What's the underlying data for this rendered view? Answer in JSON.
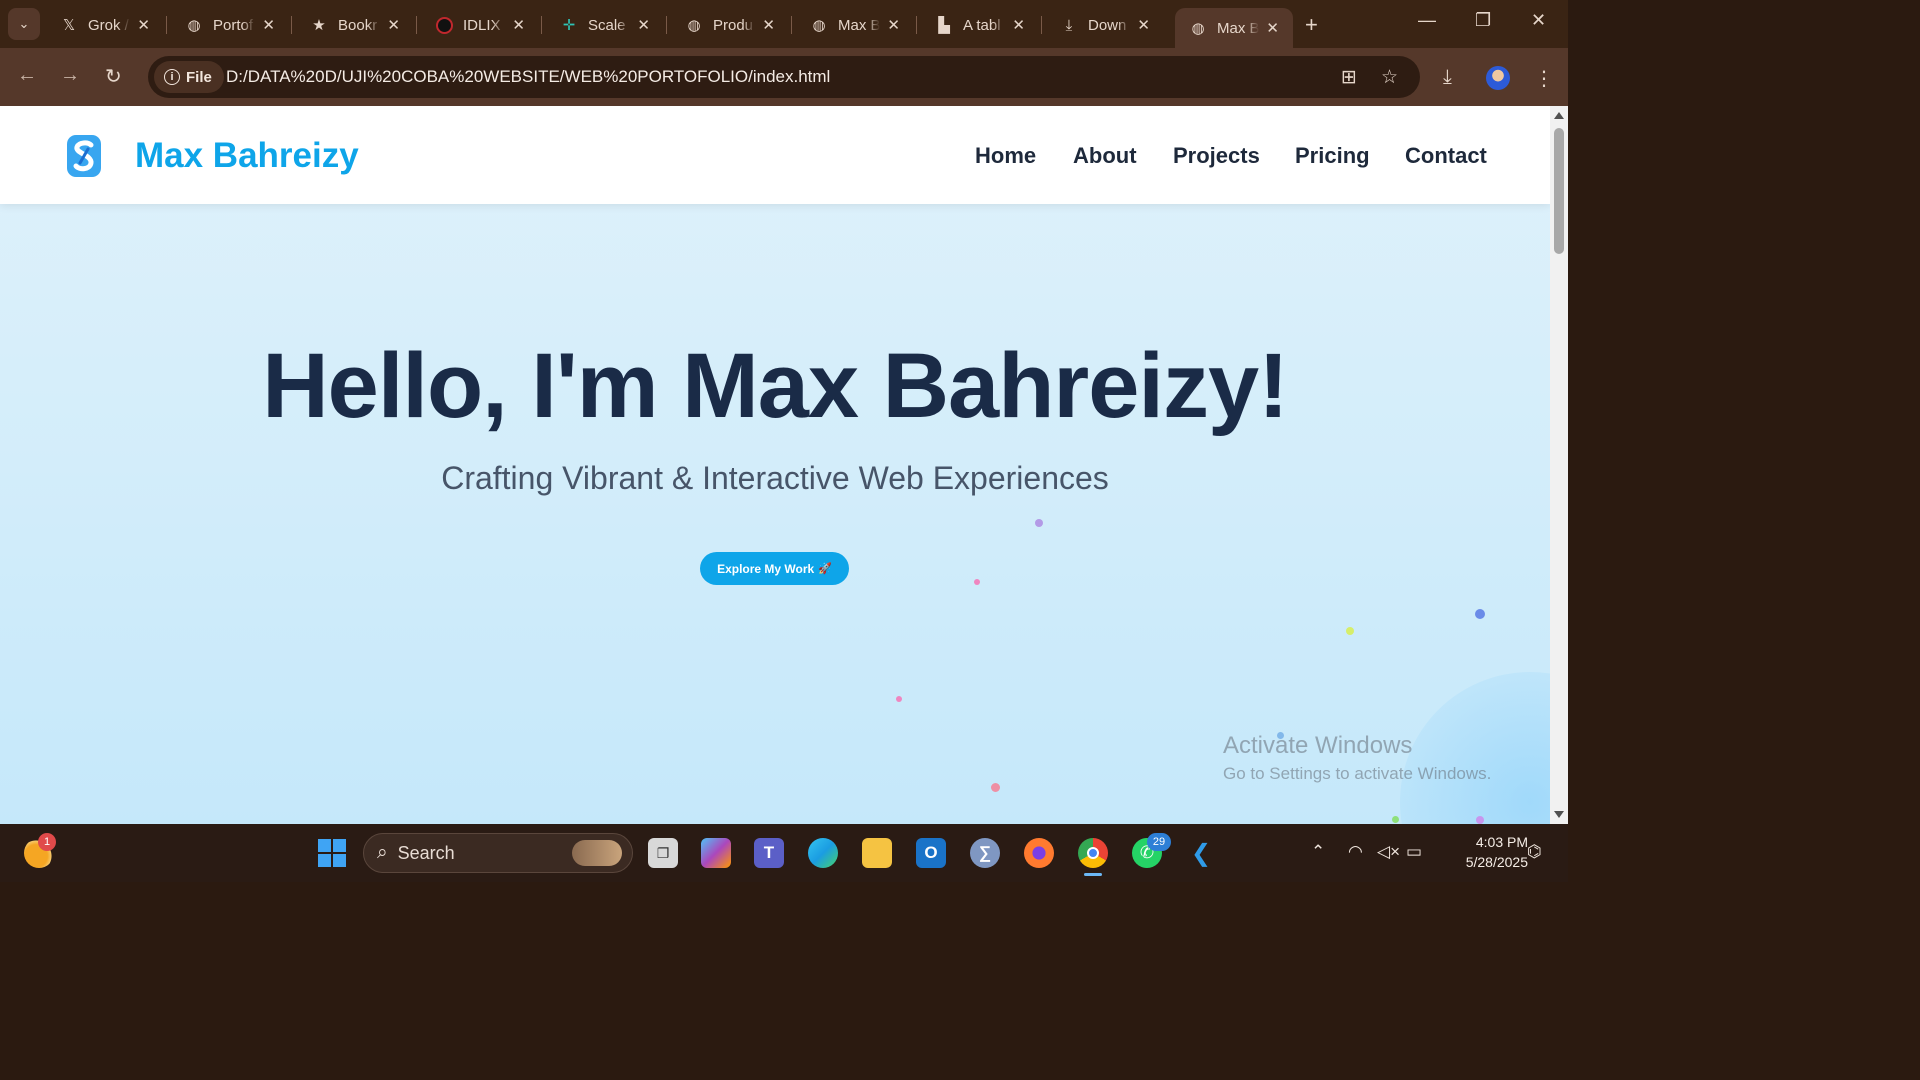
{
  "browser": {
    "tabs": [
      {
        "title": "Grok /",
        "icon": "x-logo-icon"
      },
      {
        "title": "Portof",
        "icon": "globe-icon"
      },
      {
        "title": "Bookr",
        "icon": "star-icon"
      },
      {
        "title": "IDLIX",
        "icon": "idlix-icon"
      },
      {
        "title": "Scale",
        "icon": "scale-icon"
      },
      {
        "title": "Produ",
        "icon": "globe-icon"
      },
      {
        "title": "Max B",
        "icon": "globe-icon"
      },
      {
        "title": "A tabl",
        "icon": "table-icon"
      },
      {
        "title": "Down",
        "icon": "download-icon"
      },
      {
        "title": "Max B",
        "icon": "globe-icon",
        "active": true
      }
    ],
    "address_chip": "File",
    "url": "D:/DATA%20D/UJI%20COBA%20WEBSITE/WEB%20PORTOFOLIO/index.html"
  },
  "site": {
    "brand": "Max Bahreizy",
    "nav": [
      "Home",
      "About",
      "Projects",
      "Pricing",
      "Contact"
    ],
    "hero_title": "Hello, I'm Max Bahreizy!",
    "hero_subtitle": "Crafting Vibrant & Interactive Web Experiences",
    "cta_label": "Explore My Work",
    "cta_emoji": "🚀",
    "accent_color": "#0ea5e9",
    "heading_color": "#1a2b47"
  },
  "watermark": {
    "title": "Activate Windows",
    "subtitle": "Go to Settings to activate Windows."
  },
  "taskbar": {
    "search_label": "Search",
    "weather_badge": "1",
    "whatsapp_badge": "29",
    "time": "4:03 PM",
    "date": "5/28/2025"
  }
}
